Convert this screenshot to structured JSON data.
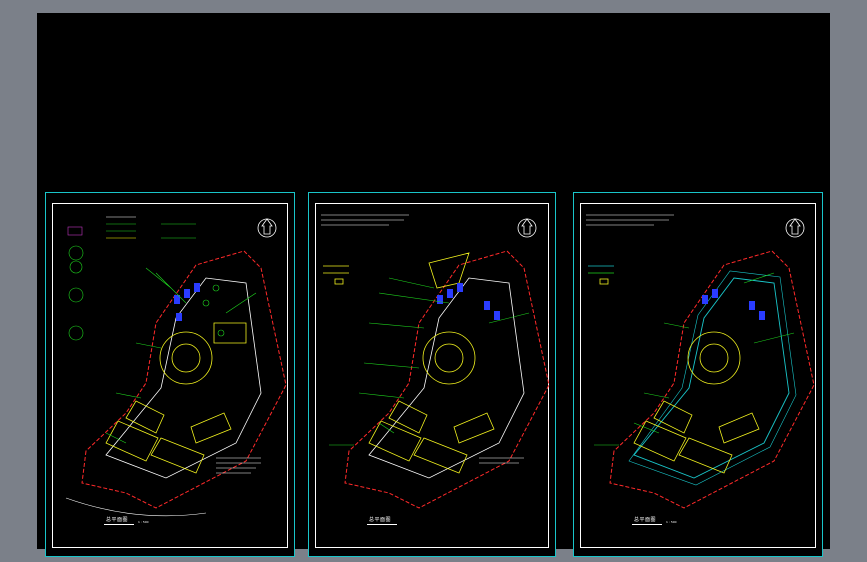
{
  "drawing": {
    "background": "#000000",
    "frame_color": "#19c5c9",
    "sheets": [
      {
        "title": "总平面图",
        "scale": "1 : 500"
      },
      {
        "title": "总平面图",
        "scale": ""
      },
      {
        "title": "总平面图",
        "scale": "1 : 500"
      }
    ]
  },
  "colors": {
    "boundary": "#ff2a2a",
    "building": "#f2f21e",
    "road": "#ffffff",
    "green": "#1ed41e",
    "blue_block": "#2a3cff",
    "cyan": "#19c5c9"
  }
}
